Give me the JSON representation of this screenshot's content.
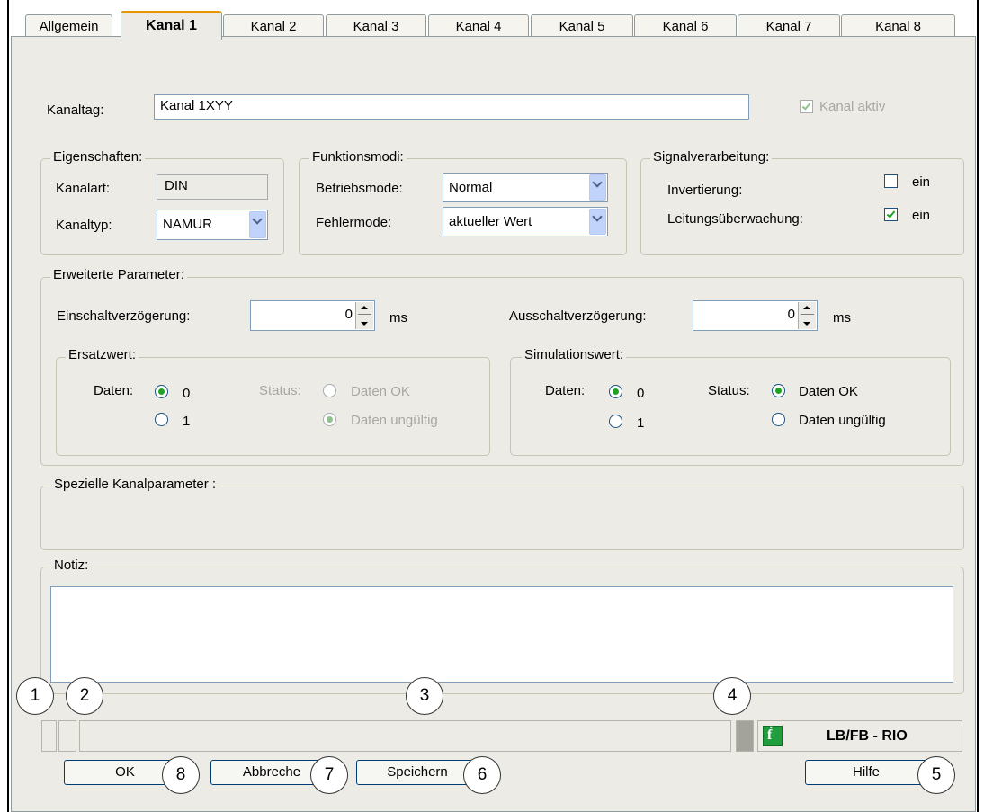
{
  "tabs": [
    "Allgemein",
    "Kanal 1",
    "Kanal 2",
    "Kanal 3",
    "Kanal 4",
    "Kanal 5",
    "Kanal 6",
    "Kanal 7",
    "Kanal 8"
  ],
  "kanaltag": {
    "label": "Kanaltag:",
    "value": "Kanal 1XYY"
  },
  "kanal_aktiv": {
    "label": "Kanal aktiv",
    "checked": true
  },
  "eigenschaften": {
    "title": "Eigenschaften:",
    "kanalart_label": "Kanalart:",
    "kanalart_value": "DIN",
    "kanaltyp_label": "Kanaltyp:",
    "kanaltyp_value": "NAMUR"
  },
  "funktionsmodi": {
    "title": "Funktionsmodi:",
    "betriebsmode_label": "Betriebsmode:",
    "betriebsmode_value": "Normal",
    "fehlermode_label": "Fehlermode:",
    "fehlermode_value": "aktueller Wert"
  },
  "signalverarbeitung": {
    "title": "Signalverarbeitung:",
    "invertierung_label": "Invertierung:",
    "invertierung_checked": false,
    "leitung_label": "Leitungsüberwachung:",
    "leitung_checked": true,
    "ein_label": "ein"
  },
  "erweitert": {
    "title": "Erweiterte Parameter:",
    "einschalt_label": "Einschaltverzögerung:",
    "einschalt_value": "0",
    "ausschalt_label": "Ausschaltverzögerung:",
    "ausschalt_value": "0",
    "unit": "ms"
  },
  "ersatzwert": {
    "title": "Ersatzwert:",
    "daten_label": "Daten:",
    "opt0": "0",
    "opt1": "1",
    "daten_selected": "0",
    "status_label": "Status:",
    "status_ok": "Daten OK",
    "status_bad": "Daten ungültig",
    "status_selected": "Daten ungültig"
  },
  "simulationswert": {
    "title": "Simulationswert:",
    "daten_label": "Daten:",
    "opt0": "0",
    "opt1": "1",
    "daten_selected": "0",
    "status_label": "Status:",
    "status_ok": "Daten OK",
    "status_bad": "Daten ungültig",
    "status_selected": "Daten OK"
  },
  "spezielle": {
    "title": "Spezielle Kanalparameter :"
  },
  "notiz": {
    "title": "Notiz:",
    "value": ""
  },
  "brand": {
    "text": "LB/FB - RIO",
    "logo_color": "#1f9e3b"
  },
  "buttons": {
    "ok": "OK",
    "abbrechen": "Abbreche",
    "speichern": "Speichern",
    "hilfe": "Hilfe"
  },
  "callouts": {
    "c1": "1",
    "c2": "2",
    "c3": "3",
    "c4": "4",
    "c5": "5",
    "c6": "6",
    "c7": "7",
    "c8": "8"
  }
}
